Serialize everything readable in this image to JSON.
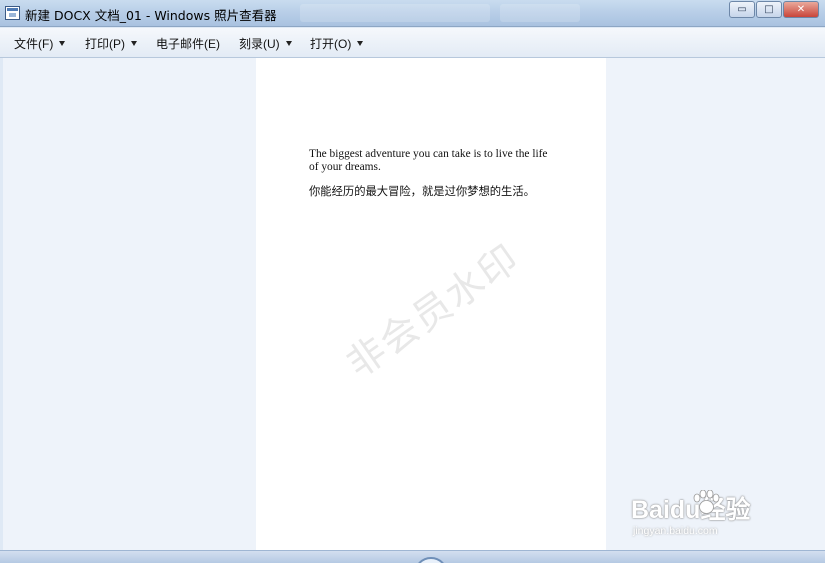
{
  "window": {
    "title": "新建 DOCX 文档_01 - Windows 照片查看器",
    "app_icon": "photo-viewer-icon",
    "controls": {
      "minimize": "▭",
      "maximize": "□",
      "close": "✕"
    }
  },
  "menu": {
    "items": [
      {
        "label": "文件(F)",
        "has_dropdown": true
      },
      {
        "label": "打印(P)",
        "has_dropdown": true
      },
      {
        "label": "电子邮件(E)",
        "has_dropdown": false
      },
      {
        "label": "刻录(U)",
        "has_dropdown": true
      },
      {
        "label": "打开(O)",
        "has_dropdown": true
      }
    ]
  },
  "document": {
    "english_text": "The biggest adventure you can take is to live the life of your dreams.",
    "chinese_text": "你能经历的最大冒险，就是过你梦想的生活。",
    "watermark": "非会员水印"
  },
  "overlay": {
    "brand": "Baidu经验",
    "url": "jingyan.baidu.com"
  },
  "colors": {
    "titlebar": "#b9cfe8",
    "menubar": "#e3ebf5",
    "viewer_bg": "#eef3fa",
    "page_bg": "#ffffff"
  }
}
